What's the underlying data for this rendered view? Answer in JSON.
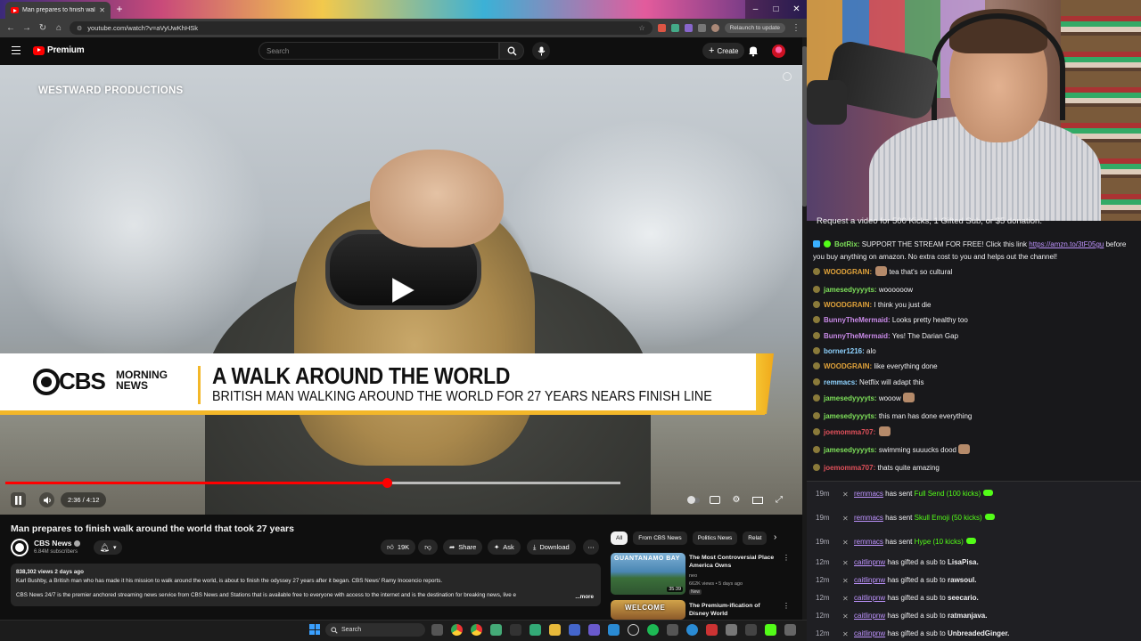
{
  "browser": {
    "tab_title": "Man prepares to finish walk",
    "url": "youtube.com/watch?v=aVyUwKhHSk",
    "relaunch_label": "Relaunch to update"
  },
  "youtube_header": {
    "brand": "Premium",
    "search_placeholder": "Search",
    "create_label": "Create"
  },
  "video": {
    "watermark": "WESTWARD PRODUCTIONS",
    "lower_third": {
      "brand": "CBS",
      "brand_sub_1": "MORNING",
      "brand_sub_2": "NEWS",
      "headline": "A WALK AROUND THE WORLD",
      "subhead": "BRITISH MAN WALKING AROUND THE WORLD FOR 27 YEARS NEARS FINISH LINE"
    },
    "time": "2:36 / 4:12",
    "progress_fraction": 0.62,
    "buffer_fraction": 1.0
  },
  "watch": {
    "title": "Man prepares to finish walk around the world that took 27 years",
    "channel_name": "CBS News",
    "channel_subs": "6.84M subscribers",
    "likes": "19K",
    "share_label": "Share",
    "ask_label": "Ask",
    "download_label": "Download",
    "description": {
      "meta": "838,302 views  2 days ago",
      "line1": "Karl Bushby, a British man who has made it his mission to walk around the world, is about to finish the odyssey 27 years after it began. CBS News' Ramy Inocencio reports.",
      "line2": "CBS News 24/7 is the premier anchored streaming news service from CBS News and Stations that is available free to everyone with access to the internet and is the destination for breaking news, live e",
      "more": "...more"
    }
  },
  "recommendations": {
    "chips": [
      "All",
      "From CBS News",
      "Politics News",
      "Relat"
    ],
    "items": [
      {
        "thumb_label": "GUANTANAMO BAY",
        "duration": "35:39",
        "title": "The Most Controversial Place America Owns",
        "channel": "neo",
        "views": "662K views • 5 days ago",
        "badge": "New"
      },
      {
        "thumb_label": "WELCOME",
        "title": "The Premium-ification of Disney World"
      }
    ]
  },
  "taskbar": {
    "search_label": "Search"
  },
  "chat": {
    "banner": "Request a video for 500 Kicks, 1 Gifted Sub, or $5 donation.",
    "bot_message": {
      "user": "BotRix:",
      "text_before": "SUPPORT THE STREAM FOR FREE! Click this link",
      "link": "https://amzn.to/3tF05gu",
      "text_after": "before you buy anything on amazon. No extra cost to you and helps out the channel!"
    },
    "messages": [
      {
        "user": "WOODGRAIN:",
        "text": "tea that's so cultural",
        "color": "#e0a23a",
        "emote": true
      },
      {
        "user": "jamesedyyyyts:",
        "text": "woooooow",
        "color": "#7ee05a",
        "emote": false
      },
      {
        "user": "WOODGRAIN:",
        "text": "I think you just die",
        "color": "#e0a23a",
        "emote": false
      },
      {
        "user": "BunnyTheMermaid:",
        "text": "Looks pretty healthy too",
        "color": "#c98ae8",
        "emote": false
      },
      {
        "user": "BunnyTheMermaid:",
        "text": "Yes! The Darian Gap",
        "color": "#c98ae8",
        "emote": false
      },
      {
        "user": "borner1216:",
        "text": "alo",
        "color": "#8fd3ff",
        "emote": false
      },
      {
        "user": "WOODGRAIN:",
        "text": "like everything done",
        "color": "#e0a23a",
        "emote": false
      },
      {
        "user": "remmacs:",
        "text": "Netflix will adapt this",
        "color": "#8fd3ff",
        "emote": false
      },
      {
        "user": "jamesedyyyyts:",
        "text": "wooow",
        "color": "#7ee05a",
        "emote": true
      },
      {
        "user": "jamesedyyyyts:",
        "text": "this man has done everything",
        "color": "#7ee05a",
        "emote": false
      },
      {
        "user": "joemomma707:",
        "text": "",
        "color": "#e0505a",
        "emote": true
      },
      {
        "user": "jamesedyyyyts:",
        "text": "swimming suuucks dood",
        "color": "#7ee05a",
        "emote": true
      },
      {
        "user": "joemomma707:",
        "text": "thats quite amazing",
        "color": "#e0505a",
        "emote": false
      }
    ],
    "events": [
      {
        "time": "19m",
        "user": "remmacs",
        "action": "has sent",
        "item": "Full Send (100 kicks)",
        "kicks": true
      },
      {
        "time": "19m",
        "user": "remmacs",
        "action": "has sent",
        "item": "Skull Emoji (50 kicks)",
        "kicks": true
      },
      {
        "time": "19m",
        "user": "remmacs",
        "action": "has sent",
        "item": "Hype (10 kicks)",
        "kicks": true
      },
      {
        "time": "12m",
        "user": "caitlinpnw",
        "action": "has gifted a sub to",
        "item": "LisaPisa.",
        "kicks": false
      },
      {
        "time": "12m",
        "user": "caitlinpnw",
        "action": "has gifted a sub to",
        "item": "rawsoul.",
        "kicks": false
      },
      {
        "time": "12m",
        "user": "caitlinpnw",
        "action": "has gifted a sub to",
        "item": "seecario.",
        "kicks": false
      },
      {
        "time": "12m",
        "user": "caitlinpnw",
        "action": "has gifted a sub to",
        "item": "ratmanjava.",
        "kicks": false
      },
      {
        "time": "12m",
        "user": "caitlinpnw",
        "action": "has gifted a sub to",
        "item": "UnbreadedGinger.",
        "kicks": false
      }
    ]
  }
}
